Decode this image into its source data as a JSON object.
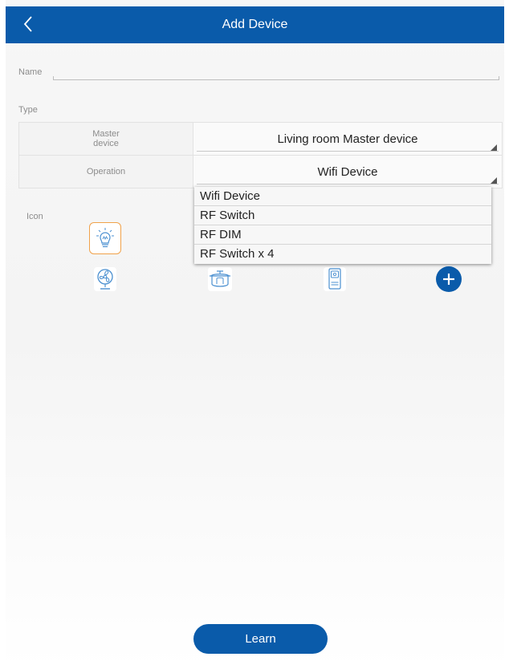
{
  "header": {
    "title": "Add Device",
    "back_icon": "chevron-left-icon"
  },
  "form": {
    "name_label": "Name",
    "name_value": "",
    "type_label": "Type",
    "rows": [
      {
        "label": "Master\ndevice",
        "value": "Living room Master device"
      },
      {
        "label": "Operation",
        "value": "Wifi Device"
      }
    ],
    "icon_label": "Icon"
  },
  "dropdown": {
    "options": [
      "Wifi Device",
      "RF Switch",
      "RF DIM",
      "RF Switch x 4"
    ]
  },
  "icons": {
    "items": [
      "light-bulb-icon",
      "fan-icon",
      "rice-cooker-icon",
      "remote-control-icon",
      "add-icon"
    ],
    "selected": "light-bulb-icon"
  },
  "actions": {
    "learn_label": "Learn"
  },
  "colors": {
    "primary": "#0a5baa",
    "selected_border": "#f0a24a",
    "icon_stroke": "#4a8fd0"
  }
}
